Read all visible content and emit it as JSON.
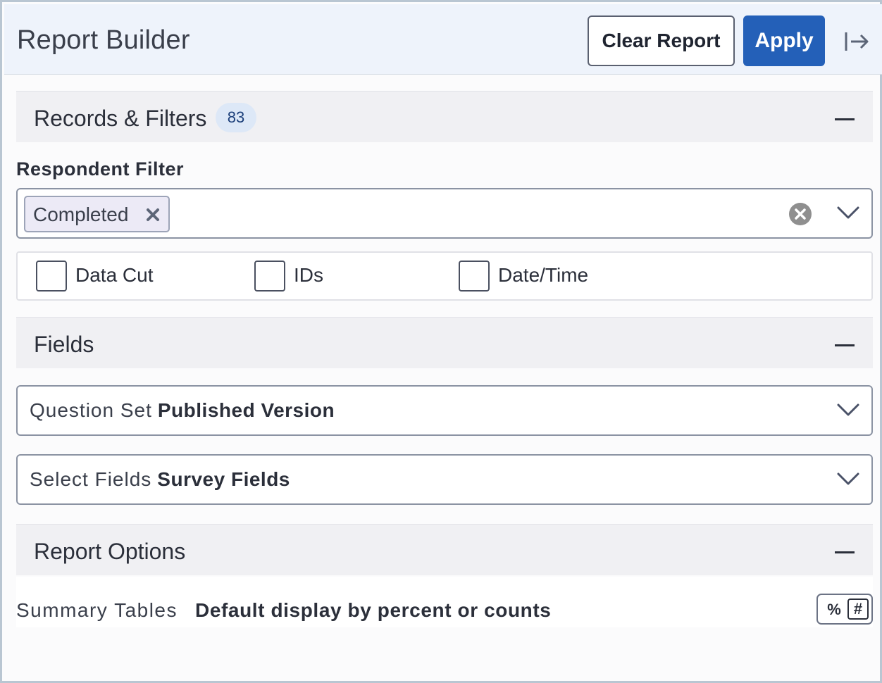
{
  "header": {
    "title": "Report Builder",
    "clear_label": "Clear Report",
    "apply_label": "Apply",
    "collapse_icon": "collapse-panel-icon"
  },
  "records_filters": {
    "title": "Records & Filters",
    "count": "83",
    "respondent_filter_label": "Respondent Filter",
    "selected_chip": "Completed",
    "checkboxes": [
      {
        "label": "Data Cut",
        "checked": false
      },
      {
        "label": "IDs",
        "checked": false
      },
      {
        "label": "Date/Time",
        "checked": false
      }
    ]
  },
  "fields": {
    "title": "Fields",
    "question_set": {
      "prefix": "Question Set",
      "value": "Published Version"
    },
    "select_fields": {
      "prefix": "Select Fields",
      "value": "Survey Fields"
    }
  },
  "report_options": {
    "title": "Report Options",
    "summary_tables": {
      "prefix": "Summary Tables",
      "value": "Default display by percent or counts"
    },
    "toggle": {
      "percent": "%",
      "count": "#",
      "selected": "#"
    }
  },
  "colors": {
    "accent": "#2460b8",
    "badge_bg": "#dde8f7",
    "header_bg": "#eef3fb",
    "section_bg": "#f0f0f3"
  }
}
